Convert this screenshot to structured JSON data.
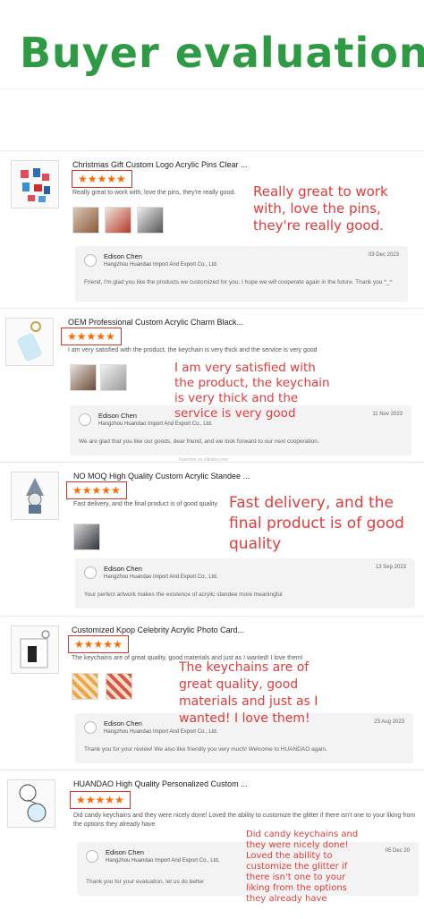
{
  "banner": {
    "title": "Buyer evaluation"
  },
  "reviews": [
    {
      "product_title": "Christmas Gift Custom Logo Acrylic Pins Clear ...",
      "rating": "★★★★★",
      "text": "Really great to work with, love the pins, they're really good.",
      "seller_name": "Edison Chen",
      "seller_company": "Hangzhou Huandao Import And Export Co., Ltd.",
      "reply_date": "03 Dec 2023",
      "reply_text": "Friend, I'm glad you like the products we customized for you. I hope we will cooperate again in the future. Thank you  *_^",
      "annotation": "Really great to work with, love the pins, they're really good."
    },
    {
      "product_title": "OEM Professional Custom Acrylic Charm Black...",
      "rating": "★★★★★",
      "text": "I am very satisfied with the product, the keychain is very thick and the service is very good",
      "seller_name": "Edison Chen",
      "seller_company": "Hangzhou Huandao Import And Export Co., Ltd.",
      "reply_date": "11 Nov 2023",
      "reply_text": "We are glad that you like our goods, dear friend, and we look forward to our next cooperation.",
      "annotation": "I am very satisfied with the product, the keychain is very thick and the service is very good",
      "watermark": "huandao.en.alibaba.com"
    },
    {
      "product_title": "NO MOQ High Quality Custom Acrylic Standee ...",
      "rating": "★★★★★",
      "text": "Fast delivery, and the final product is of good quality",
      "seller_name": "Edison Chen",
      "seller_company": "Hangzhou Huandao Import And Export Co., Ltd.",
      "reply_date": "13 Sep 2023",
      "reply_text": "Your perfect artwork makes the existence of acrylic standee more meaningful",
      "annotation": "Fast delivery, and the final product is of good quality"
    },
    {
      "product_title": "Customized Kpop Celebrity Acrylic Photo Card...",
      "rating": "★★★★★",
      "text": "The keychains are of great quality, good materials and just as I wanted! I love them!",
      "seller_name": "Edison Chen",
      "seller_company": "Hangzhou Huandao Import And Export Co., Ltd.",
      "reply_date": "23 Aug 2023",
      "reply_text": "Thank you for your review! We also like friendly you very much! Welcome to HUANDAO again.",
      "annotation": "The keychains are of great quality, good materials and just as I wanted! I love them!"
    },
    {
      "product_title": "HUANDAO High Quality Personalized Custom ...",
      "rating": "★★★★★",
      "text": "Did candy keychains and they were nicely done! Loved the ability to customize the glitter if there isn't one to your liking from the options they already have",
      "seller_name": "Edison Chen",
      "seller_company": "Hangzhou Huandao Import And Export Co., Ltd.",
      "reply_date": "05 Dec 20",
      "reply_text": "Thank you for your evaluation, let us do better",
      "annotation": "Did candy keychains and they were nicely done! Loved the ability to customize the glitter if there isn't one to your liking from the options they already have"
    }
  ]
}
